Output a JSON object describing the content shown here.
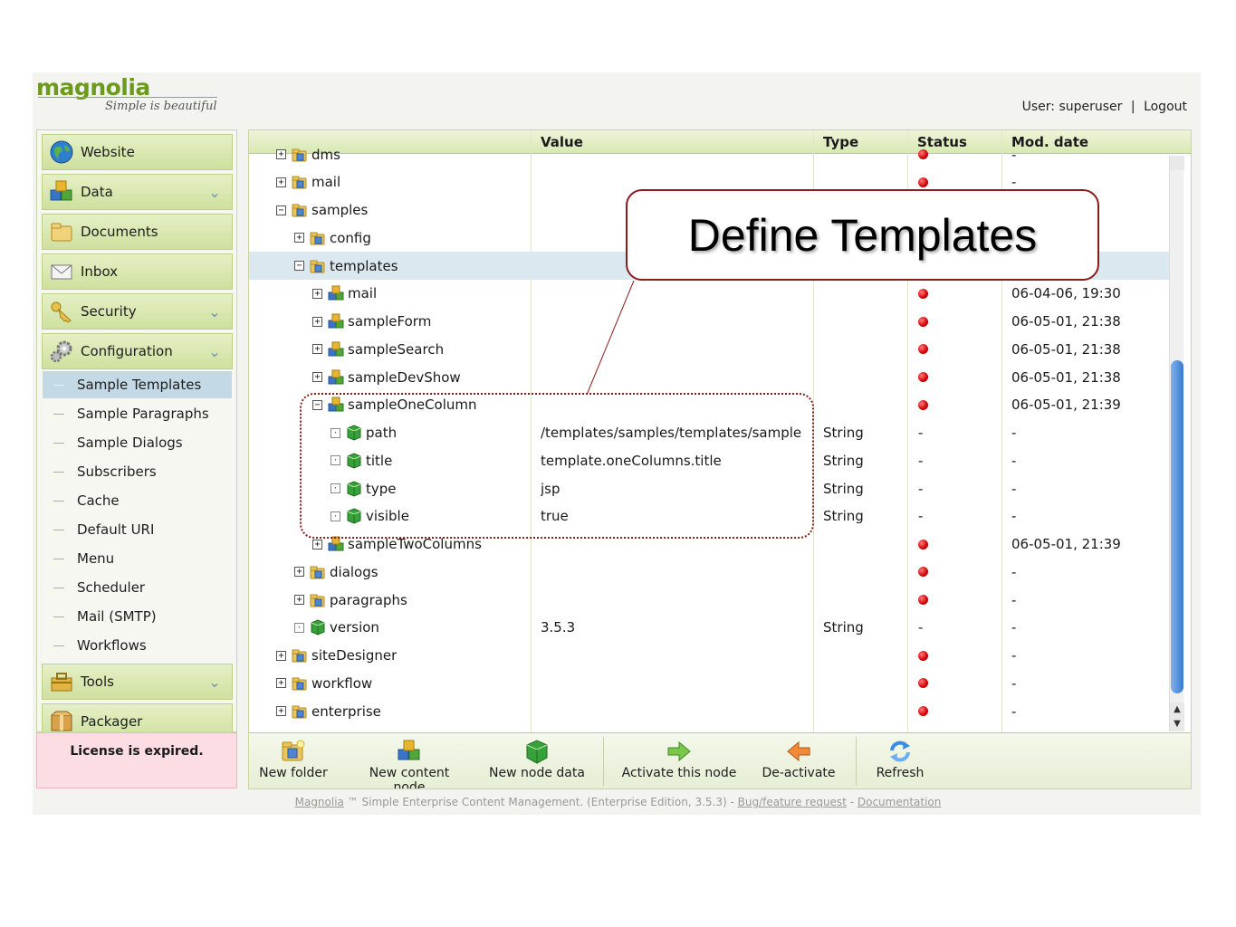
{
  "app": {
    "logo_text": "magnolia",
    "tagline": "Simple is beautiful",
    "user_label": "User: superuser",
    "separator": "|",
    "logout_label": "Logout"
  },
  "sidebar": {
    "menus": [
      {
        "label": "Website",
        "icon": "globe-icon",
        "expandable": false
      },
      {
        "label": "Data",
        "icon": "data-cubes-icon",
        "expandable": true
      },
      {
        "label": "Documents",
        "icon": "folder-icon",
        "expandable": false
      },
      {
        "label": "Inbox",
        "icon": "envelope-icon",
        "expandable": false
      },
      {
        "label": "Security",
        "icon": "key-icon",
        "expandable": true
      },
      {
        "label": "Configuration",
        "icon": "gears-icon",
        "expandable": true
      }
    ],
    "config_items": [
      {
        "label": "Sample Templates",
        "active": true
      },
      {
        "label": "Sample Paragraphs",
        "active": false
      },
      {
        "label": "Sample Dialogs",
        "active": false
      },
      {
        "label": "Subscribers",
        "active": false
      },
      {
        "label": "Cache",
        "active": false
      },
      {
        "label": "Default URI",
        "active": false
      },
      {
        "label": "Menu",
        "active": false
      },
      {
        "label": "Scheduler",
        "active": false
      },
      {
        "label": "Mail (SMTP)",
        "active": false
      },
      {
        "label": "Workflows",
        "active": false
      }
    ],
    "bottom_menus": [
      {
        "label": "Tools",
        "icon": "toolbox-icon",
        "expandable": true
      },
      {
        "label": "Packager",
        "icon": "package-icon",
        "expandable": false
      }
    ],
    "license_text": "License is expired."
  },
  "table": {
    "headers": {
      "name": "",
      "value": "Value",
      "type": "Type",
      "status": "Status",
      "modified": "Mod. date"
    },
    "rows": [
      {
        "level": 0,
        "toggle": "+",
        "icon": "folder",
        "name": "dms",
        "value": "",
        "type": "",
        "status": "red",
        "modified": "-"
      },
      {
        "level": 0,
        "toggle": "+",
        "icon": "folder",
        "name": "mail",
        "value": "",
        "type": "",
        "status": "red",
        "modified": "-"
      },
      {
        "level": 0,
        "toggle": "-",
        "icon": "folder",
        "name": "samples",
        "value": "",
        "type": "",
        "status": "",
        "modified": ""
      },
      {
        "level": 1,
        "toggle": "+",
        "icon": "folder",
        "name": "config",
        "value": "",
        "type": "",
        "status": "",
        "modified": ""
      },
      {
        "level": 1,
        "toggle": "-",
        "icon": "folder",
        "name": "templates",
        "value": "",
        "type": "",
        "status": "",
        "modified": "",
        "selected": true
      },
      {
        "level": 2,
        "toggle": "+",
        "icon": "content",
        "name": "mail",
        "value": "",
        "type": "",
        "status": "red",
        "modified": "06-04-06, 19:30"
      },
      {
        "level": 2,
        "toggle": "+",
        "icon": "content",
        "name": "sampleForm",
        "value": "",
        "type": "",
        "status": "red",
        "modified": "06-05-01, 21:38"
      },
      {
        "level": 2,
        "toggle": "+",
        "icon": "content",
        "name": "sampleSearch",
        "value": "",
        "type": "",
        "status": "red",
        "modified": "06-05-01, 21:38"
      },
      {
        "level": 2,
        "toggle": "+",
        "icon": "content",
        "name": "sampleDevShow",
        "value": "",
        "type": "",
        "status": "red",
        "modified": "06-05-01, 21:38"
      },
      {
        "level": 2,
        "toggle": "-",
        "icon": "content",
        "name": "sampleOneColumn",
        "value": "",
        "type": "",
        "status": "red",
        "modified": "06-05-01, 21:39"
      },
      {
        "level": 3,
        "toggle": "·",
        "icon": "data",
        "name": "path",
        "value": "/templates/samples/templates/sample",
        "type": "String",
        "status": "-",
        "modified": "-"
      },
      {
        "level": 3,
        "toggle": "·",
        "icon": "data",
        "name": "title",
        "value": "template.oneColumns.title",
        "type": "String",
        "status": "-",
        "modified": "-"
      },
      {
        "level": 3,
        "toggle": "·",
        "icon": "data",
        "name": "type",
        "value": "jsp",
        "type": "String",
        "status": "-",
        "modified": "-"
      },
      {
        "level": 3,
        "toggle": "·",
        "icon": "data",
        "name": "visible",
        "value": "true",
        "type": "String",
        "status": "-",
        "modified": "-"
      },
      {
        "level": 2,
        "toggle": "+",
        "icon": "content",
        "name": "sampleTwoColumns",
        "value": "",
        "type": "",
        "status": "red",
        "modified": "06-05-01, 21:39"
      },
      {
        "level": 1,
        "toggle": "+",
        "icon": "folder",
        "name": "dialogs",
        "value": "",
        "type": "",
        "status": "red",
        "modified": "-"
      },
      {
        "level": 1,
        "toggle": "+",
        "icon": "folder",
        "name": "paragraphs",
        "value": "",
        "type": "",
        "status": "red",
        "modified": "-"
      },
      {
        "level": 1,
        "toggle": "·",
        "icon": "data",
        "name": "version",
        "value": "3.5.3",
        "type": "String",
        "status": "-",
        "modified": "-"
      },
      {
        "level": 0,
        "toggle": "+",
        "icon": "folder",
        "name": "siteDesigner",
        "value": "",
        "type": "",
        "status": "red",
        "modified": "-"
      },
      {
        "level": 0,
        "toggle": "+",
        "icon": "folder",
        "name": "workflow",
        "value": "",
        "type": "",
        "status": "red",
        "modified": "-"
      },
      {
        "level": 0,
        "toggle": "+",
        "icon": "folder",
        "name": "enterprise",
        "value": "",
        "type": "",
        "status": "red",
        "modified": "-"
      }
    ]
  },
  "toolbar": {
    "new_folder": "New folder",
    "new_content_node": "New content node",
    "new_node_data": "New node data",
    "activate": "Activate this node",
    "deactivate": "De-activate",
    "refresh": "Refresh"
  },
  "footer": {
    "brand": "Magnolia",
    "text": " ™ Simple Enterprise Content Management. (Enterprise Edition, 3.5.3) - ",
    "bug_link": "Bug/feature request",
    "dash": " - ",
    "doc_link": "Documentation"
  },
  "callout": {
    "text": "Define Templates"
  },
  "colors": {
    "accent_green": "#cfe09e",
    "selected_row": "#dce8f0",
    "status_red": "#d10000",
    "callout_border": "#8b1c1c"
  }
}
